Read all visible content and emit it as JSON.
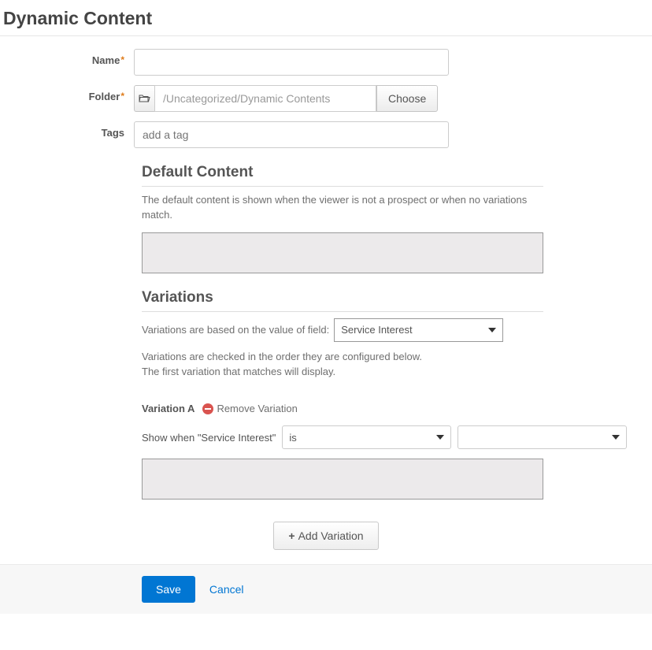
{
  "page_title": "Dynamic Content",
  "labels": {
    "name": "Name",
    "folder": "Folder",
    "tags": "Tags"
  },
  "inputs": {
    "name_value": "",
    "folder_value": "/Uncategorized/Dynamic Contents",
    "tags_placeholder": "add a tag"
  },
  "buttons": {
    "choose": "Choose",
    "add_variation": "Add Variation",
    "save": "Save",
    "cancel": "Cancel"
  },
  "sections": {
    "default_content": {
      "title": "Default Content",
      "desc": "The default content is shown when the viewer is not a prospect or when no variations match."
    },
    "variations": {
      "title": "Variations",
      "based_on_label": "Variations are based on the value of field:",
      "field_select_value": "Service Interest",
      "desc_line1": "Variations are checked in the order they are configured below.",
      "desc_line2": "The first variation that matches will display."
    }
  },
  "variation_a": {
    "name": "Variation A",
    "remove_label": "Remove Variation",
    "show_when_prefix": "Show when \"Service Interest\"",
    "operator": "is",
    "value": ""
  }
}
